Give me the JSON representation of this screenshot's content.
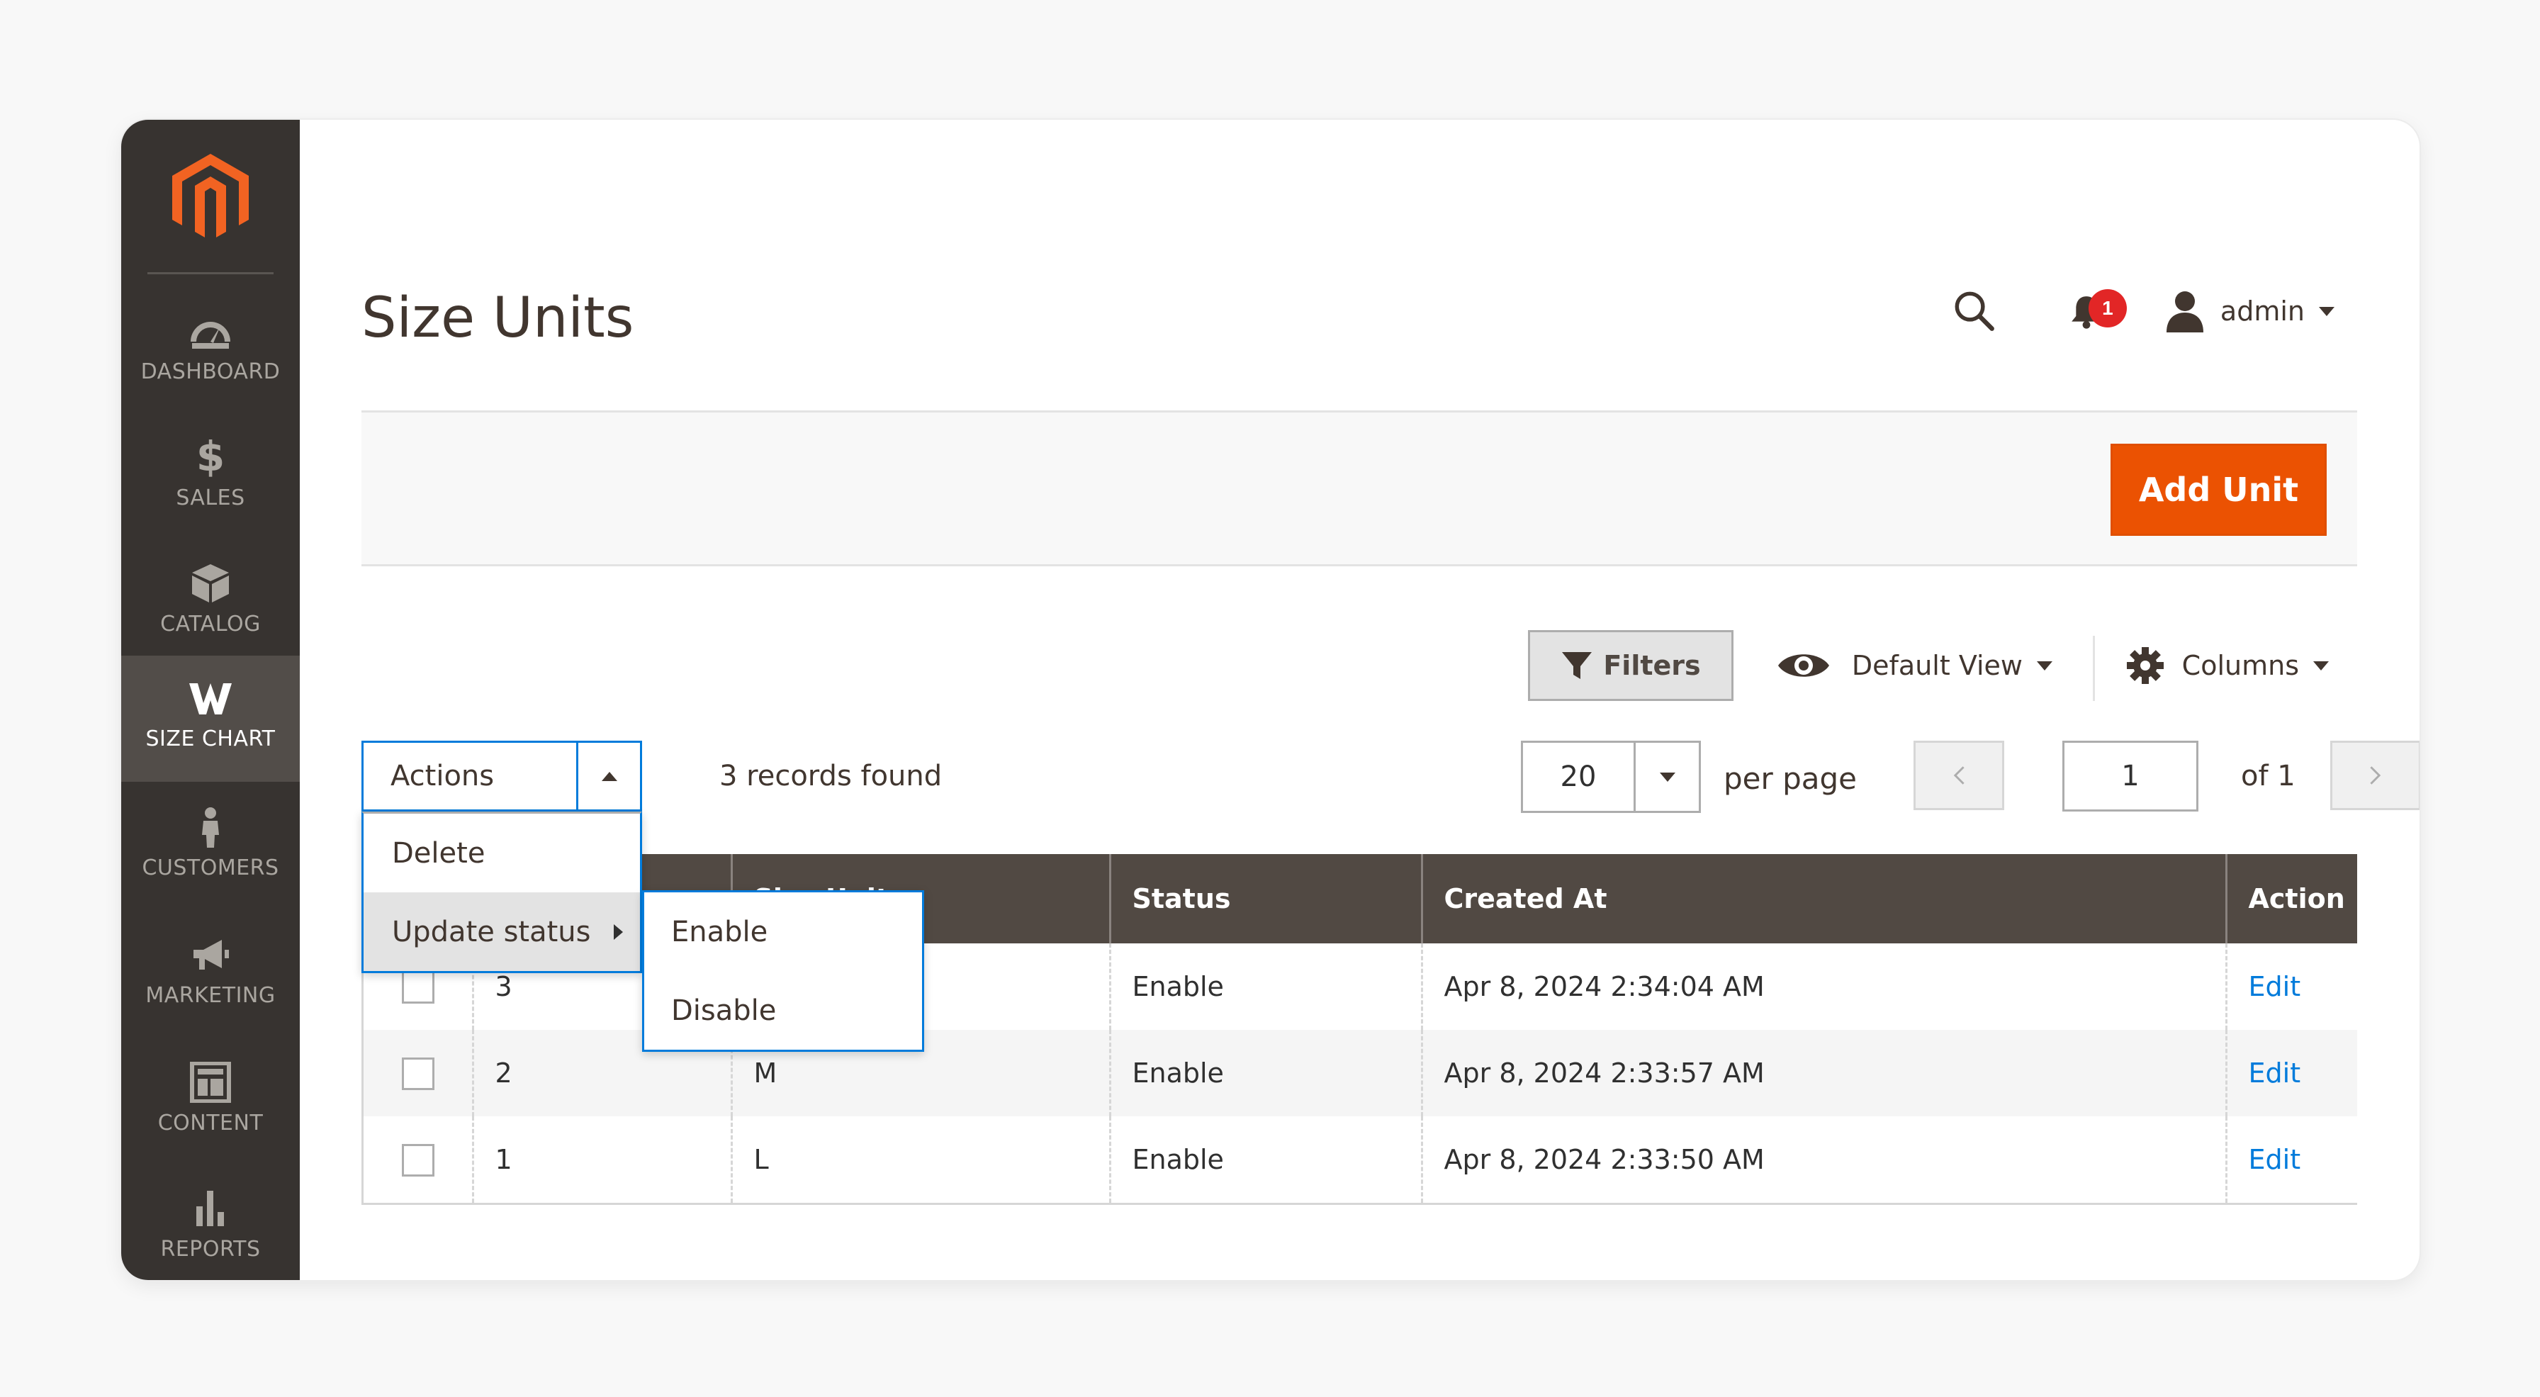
{
  "sidebar": {
    "items": [
      {
        "label": "DASHBOARD",
        "icon": "dashboard-icon"
      },
      {
        "label": "SALES",
        "icon": "dollar-icon"
      },
      {
        "label": "CATALOG",
        "icon": "box-icon"
      },
      {
        "label": "SIZE CHART",
        "icon": "size-chart-icon"
      },
      {
        "label": "CUSTOMERS",
        "icon": "person-icon"
      },
      {
        "label": "MARKETING",
        "icon": "megaphone-icon"
      },
      {
        "label": "CONTENT",
        "icon": "layout-icon"
      },
      {
        "label": "REPORTS",
        "icon": "bar-chart-icon"
      }
    ],
    "active": "SIZE CHART"
  },
  "header": {
    "title": "Size Units",
    "notifications_count": "1",
    "user": "admin"
  },
  "page_actions": {
    "add_label": "Add Unit"
  },
  "toolbar": {
    "filters": "Filters",
    "view": "Default View",
    "columns": "Columns"
  },
  "actions": {
    "label": "Actions",
    "records": "3 records found",
    "menu": [
      "Delete",
      "Update status"
    ],
    "submenu": [
      "Enable",
      "Disable"
    ]
  },
  "pager": {
    "per_page_value": "20",
    "per_page_label": "per page",
    "current": "1",
    "total": "of 1"
  },
  "table": {
    "headers": [
      "",
      "",
      "Size Unit",
      "Status",
      "Created At",
      "Action"
    ],
    "rows": [
      {
        "id": "3",
        "size": "",
        "status": "Enable",
        "created": "Apr 8, 2024 2:34:04 AM",
        "action": "Edit"
      },
      {
        "id": "2",
        "size": "M",
        "status": "Enable",
        "created": "Apr 8, 2024 2:33:57 AM",
        "action": "Edit"
      },
      {
        "id": "1",
        "size": "L",
        "status": "Enable",
        "created": "Apr 8, 2024 2:33:50 AM",
        "action": "Edit"
      }
    ]
  },
  "colors": {
    "sidebar": "#373330",
    "accent": "#eb5202",
    "header_row": "#514943",
    "link": "#007bdb"
  }
}
